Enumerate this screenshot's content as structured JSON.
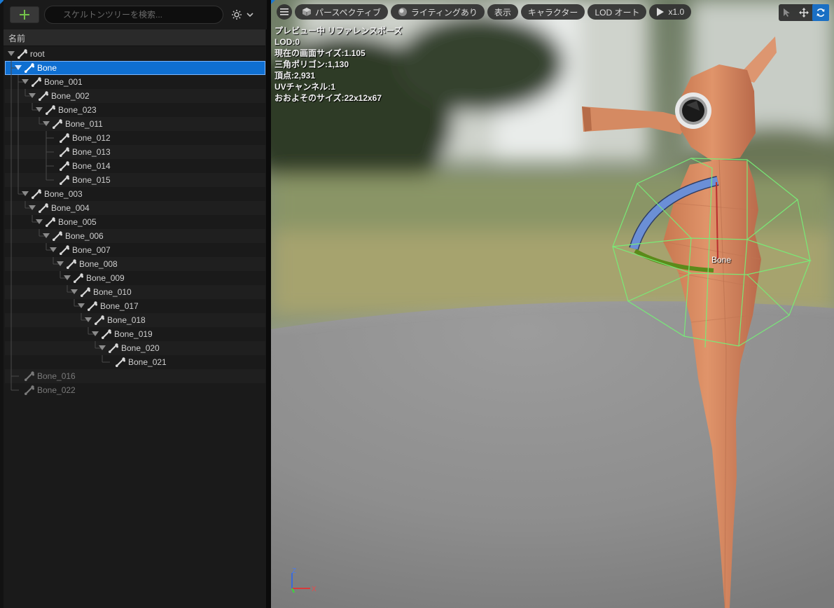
{
  "skeleton_tree": {
    "search": {
      "placeholder": "スケルトンツリーを検索..."
    },
    "column_header": "名前",
    "rows": [
      {
        "label": "root",
        "depth": 0,
        "expanded": true,
        "dim": false,
        "selected": false
      },
      {
        "label": "Bone",
        "depth": 1,
        "expanded": true,
        "dim": false,
        "selected": true
      },
      {
        "label": "Bone_001",
        "depth": 2,
        "expanded": true,
        "dim": false,
        "selected": false
      },
      {
        "label": "Bone_002",
        "depth": 3,
        "expanded": true,
        "dim": false,
        "selected": false
      },
      {
        "label": "Bone_023",
        "depth": 4,
        "expanded": true,
        "dim": false,
        "selected": false
      },
      {
        "label": "Bone_011",
        "depth": 5,
        "expanded": true,
        "dim": false,
        "selected": false
      },
      {
        "label": "Bone_012",
        "depth": 6,
        "expanded": false,
        "dim": false,
        "selected": false
      },
      {
        "label": "Bone_013",
        "depth": 6,
        "expanded": false,
        "dim": false,
        "selected": false
      },
      {
        "label": "Bone_014",
        "depth": 6,
        "expanded": false,
        "dim": false,
        "selected": false
      },
      {
        "label": "Bone_015",
        "depth": 6,
        "expanded": false,
        "dim": false,
        "selected": false
      },
      {
        "label": "Bone_003",
        "depth": 2,
        "expanded": true,
        "dim": false,
        "selected": false
      },
      {
        "label": "Bone_004",
        "depth": 3,
        "expanded": true,
        "dim": false,
        "selected": false
      },
      {
        "label": "Bone_005",
        "depth": 4,
        "expanded": true,
        "dim": false,
        "selected": false
      },
      {
        "label": "Bone_006",
        "depth": 5,
        "expanded": true,
        "dim": false,
        "selected": false
      },
      {
        "label": "Bone_007",
        "depth": 6,
        "expanded": true,
        "dim": false,
        "selected": false
      },
      {
        "label": "Bone_008",
        "depth": 7,
        "expanded": true,
        "dim": false,
        "selected": false
      },
      {
        "label": "Bone_009",
        "depth": 8,
        "expanded": true,
        "dim": false,
        "selected": false
      },
      {
        "label": "Bone_010",
        "depth": 9,
        "expanded": true,
        "dim": false,
        "selected": false
      },
      {
        "label": "Bone_017",
        "depth": 10,
        "expanded": true,
        "dim": false,
        "selected": false
      },
      {
        "label": "Bone_018",
        "depth": 11,
        "expanded": true,
        "dim": false,
        "selected": false
      },
      {
        "label": "Bone_019",
        "depth": 12,
        "expanded": true,
        "dim": false,
        "selected": false
      },
      {
        "label": "Bone_020",
        "depth": 13,
        "expanded": true,
        "dim": false,
        "selected": false
      },
      {
        "label": "Bone_021",
        "depth": 14,
        "expanded": false,
        "dim": false,
        "selected": false
      },
      {
        "label": "Bone_016",
        "depth": 1,
        "expanded": false,
        "dim": true,
        "selected": false
      },
      {
        "label": "Bone_022",
        "depth": 1,
        "expanded": false,
        "dim": true,
        "selected": false
      }
    ]
  },
  "viewport": {
    "toolbar": {
      "perspective": "パースペクティブ",
      "lighting": "ライティングあり",
      "show": "表示",
      "character": "キャラクター",
      "lod": "LOD オート",
      "play_speed": "x1.0"
    },
    "stats": [
      "プレビュー中 リファレンスポーズ",
      "LOD:0",
      "現在の画面サイズ:1.105",
      "三角ポリゴン:1,130",
      "頂点:2,931",
      "UVチャンネル:1",
      "おおよそのサイズ:22x12x67"
    ],
    "selected_bone_label": "Bone",
    "axis": {
      "z": "Z",
      "x": "X"
    }
  },
  "icons": {
    "add": "plus-icon",
    "search": "search-icon",
    "settings": "gear-icon",
    "menu": "hamburger-icon",
    "select": "cursor-icon",
    "move": "move-icon",
    "rotate": "rotate-icon"
  },
  "colors": {
    "accent": "#0f6fd1",
    "add_green": "#73c24a",
    "model": "#d98a5e",
    "collision": "#66ee66"
  }
}
